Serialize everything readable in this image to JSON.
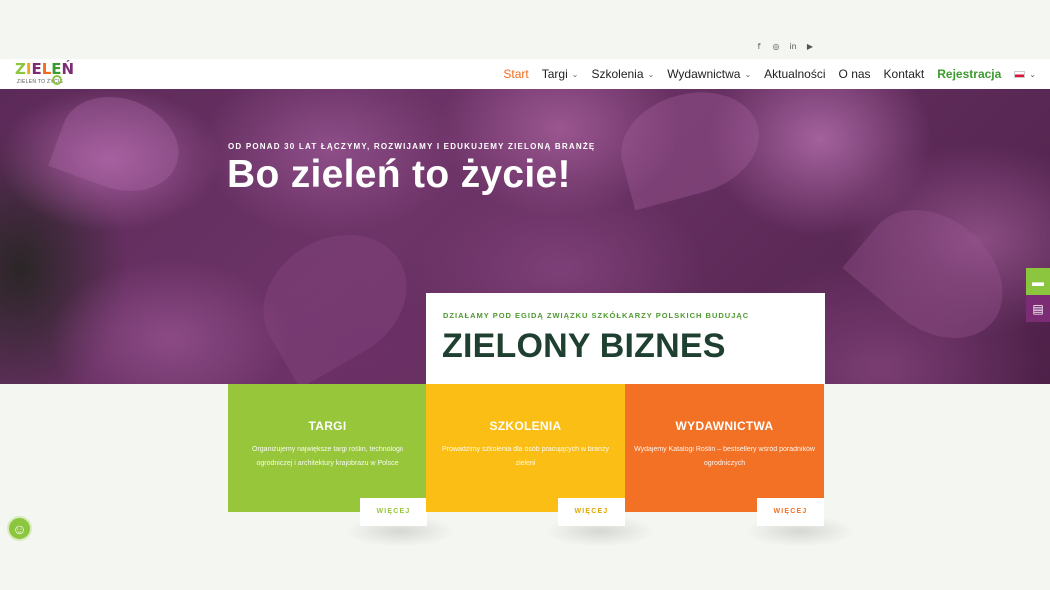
{
  "social": {
    "icons": [
      "facebook-icon",
      "instagram-icon",
      "linkedin-icon",
      "youtube-icon"
    ],
    "glyphs": [
      "f",
      "◎",
      "in",
      "▶"
    ]
  },
  "logo": {
    "letters": [
      "Z",
      "I",
      "E",
      "L",
      "E",
      "Ń"
    ],
    "colors": [
      "#8cc63f",
      "#f4a21d",
      "#7b2c75",
      "#f26b1d",
      "#3c9a2f",
      "#7b2c75"
    ],
    "tagline": "ZIELEŃ TO ŻYCIE"
  },
  "nav": {
    "items": [
      {
        "label": "Start",
        "active": true,
        "dropdown": false
      },
      {
        "label": "Targi",
        "dropdown": true
      },
      {
        "label": "Szkolenia",
        "dropdown": true
      },
      {
        "label": "Wydawnictwa",
        "dropdown": true
      },
      {
        "label": "Aktualności",
        "dropdown": false
      },
      {
        "label": "O nas",
        "dropdown": false
      },
      {
        "label": "Kontakt",
        "dropdown": false
      },
      {
        "label": "Rejestracja",
        "dropdown": false
      }
    ],
    "language_flag": "flag-pl-icon"
  },
  "hero": {
    "eyebrow": "OD PONAD 30 LAT ŁĄCZYMY, ROZWIJAMY I EDUKUJEMY ZIELONĄ BRANŻĘ",
    "title": "Bo zieleń to życie!"
  },
  "intro": {
    "eyebrow": "DZIAŁAMY POD EGIDĄ ZWIĄZKU SZKÓŁKARZY POLSKICH BUDUJĄC",
    "title": "ZIELONY BIZNES"
  },
  "cards": [
    {
      "title": "TARGI",
      "text": "Organizujemy największe targi roślin, technologii ogrodniczej i architektury krajobrazu w Polsce",
      "more": "WIĘCEJ"
    },
    {
      "title": "SZKOLENIA",
      "text": "Prowadzimy szkolenia dla osób pracujących w branży zieleni",
      "more": "WIĘCEJ"
    },
    {
      "title": "WYDAWNICTWA",
      "text": "Wydajemy Katalogi Roślin – bestsellery wśród poradników ogrodniczych",
      "more": "WIĘCEJ"
    }
  ],
  "side_buttons": [
    "ticket-icon",
    "newspaper-icon"
  ],
  "accessibility": {
    "icon": "accessibility-icon"
  },
  "colors": {
    "accent_orange": "#f26b1d",
    "brand_green": "#3c9a2f",
    "card_green": "#97c63b",
    "card_yellow": "#fbbe14",
    "card_orange": "#f27125",
    "heading_dark_green": "#1f4030",
    "purple": "#7b2c75"
  }
}
